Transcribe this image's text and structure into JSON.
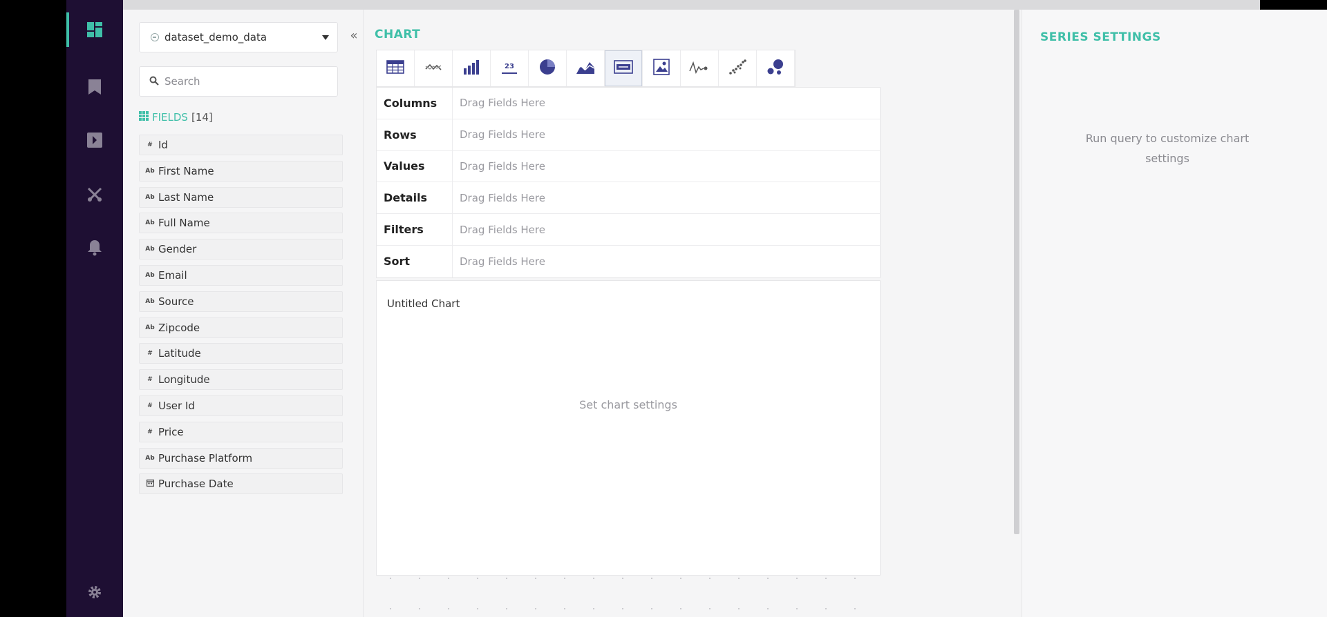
{
  "nav": {
    "items": [
      {
        "icon": "dashboard-icon"
      },
      {
        "icon": "bookmark-icon"
      },
      {
        "icon": "explore-icon"
      },
      {
        "icon": "tools-icon"
      },
      {
        "icon": "bell-icon"
      }
    ],
    "settings_icon": "gear-icon"
  },
  "fields_panel": {
    "dataset": "dataset_demo_data",
    "search_placeholder": "Search",
    "fields_label": "FIELDS",
    "fields_count": "[14]",
    "fields": [
      {
        "type": "#",
        "name": "Id"
      },
      {
        "type": "Ab",
        "name": "First Name"
      },
      {
        "type": "Ab",
        "name": "Last Name"
      },
      {
        "type": "Ab",
        "name": "Full Name"
      },
      {
        "type": "Ab",
        "name": "Gender"
      },
      {
        "type": "Ab",
        "name": "Email"
      },
      {
        "type": "Ab",
        "name": "Source"
      },
      {
        "type": "Ab",
        "name": "Zipcode"
      },
      {
        "type": "#",
        "name": "Latitude"
      },
      {
        "type": "#",
        "name": "Longitude"
      },
      {
        "type": "#",
        "name": "User Id"
      },
      {
        "type": "#",
        "name": "Price"
      },
      {
        "type": "Ab",
        "name": "Purchase Platform"
      },
      {
        "type": "date",
        "name": "Purchase Date"
      }
    ]
  },
  "chart": {
    "heading": "CHART",
    "chart_types": [
      {
        "icon": "table-chart-icon"
      },
      {
        "icon": "line-chart-icon"
      },
      {
        "icon": "bar-chart-icon"
      },
      {
        "icon": "number-chart-icon",
        "label": "23"
      },
      {
        "icon": "pie-chart-icon"
      },
      {
        "icon": "area-chart-icon"
      },
      {
        "icon": "map-chart-icon",
        "active": true
      },
      {
        "icon": "image-chart-icon"
      },
      {
        "icon": "sparkline-chart-icon"
      },
      {
        "icon": "scatter-chart-icon"
      },
      {
        "icon": "bubble-chart-icon"
      }
    ],
    "shelves": [
      {
        "label": "Columns",
        "placeholder": "Drag Fields Here"
      },
      {
        "label": "Rows",
        "placeholder": "Drag Fields Here"
      },
      {
        "label": "Values",
        "placeholder": "Drag Fields Here"
      },
      {
        "label": "Details",
        "placeholder": "Drag Fields Here"
      },
      {
        "label": "Filters",
        "placeholder": "Drag Fields Here"
      },
      {
        "label": "Sort",
        "placeholder": "Drag Fields Here"
      }
    ],
    "title": "Untitled Chart",
    "placeholder": "Set chart settings"
  },
  "series": {
    "heading": "SERIES SETTINGS",
    "message": "Run query to customize chart settings"
  },
  "right_rail": {
    "icons": [
      "series-settings-icon",
      "report-settings-icon",
      "history-icon"
    ]
  },
  "colors": {
    "accent": "#3fbfa8",
    "nav_bg": "#1e0f33",
    "chart_icon": "#3b3f8f"
  }
}
